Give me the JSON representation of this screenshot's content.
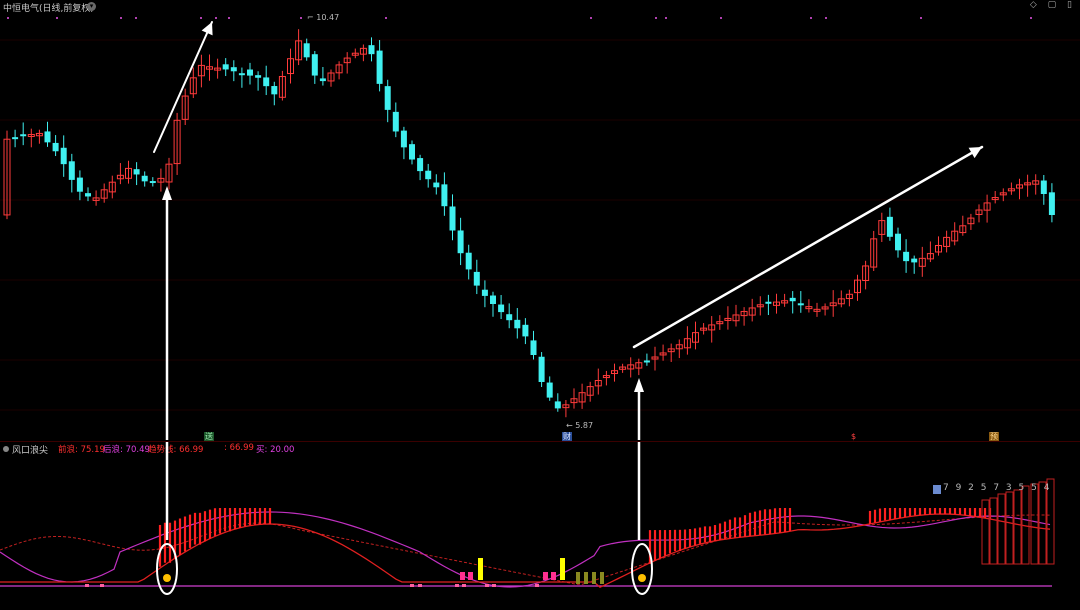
{
  "header": {
    "title": "中恒电气(日线,前复权)",
    "window_controls": "◇ ▢ ▯"
  },
  "price_chart": {
    "high_label": "10.47",
    "low_label": "5.87",
    "colors": {
      "up": "#ff3b3b",
      "down": "#40f0f0",
      "flat": "#ffffff",
      "annotation_arrow": "#ffffff"
    }
  },
  "event_tags": [
    {
      "text": "送",
      "color": "#2fa84f"
    },
    {
      "text": "财",
      "color": "#3f6fd0"
    },
    {
      "text": "$",
      "color": "#ff3030"
    },
    {
      "text": "预",
      "color": "#d0a030"
    }
  ],
  "indicator": {
    "name": "风口浪尖",
    "values": [
      {
        "label": "前浪: 75.19",
        "color": "#ff3030"
      },
      {
        "label": "后浪: 70.49",
        "color": "#e040e0"
      },
      {
        "label": "趋势线: 66.99",
        "color": "#ff3030"
      },
      {
        "label": ": 66.99",
        "color": "#ff3030"
      },
      {
        "label": "买: 20.00",
        "color": "#e040e0"
      }
    ],
    "countdown": "7 9 2 5 7 3 5 5 4"
  }
}
